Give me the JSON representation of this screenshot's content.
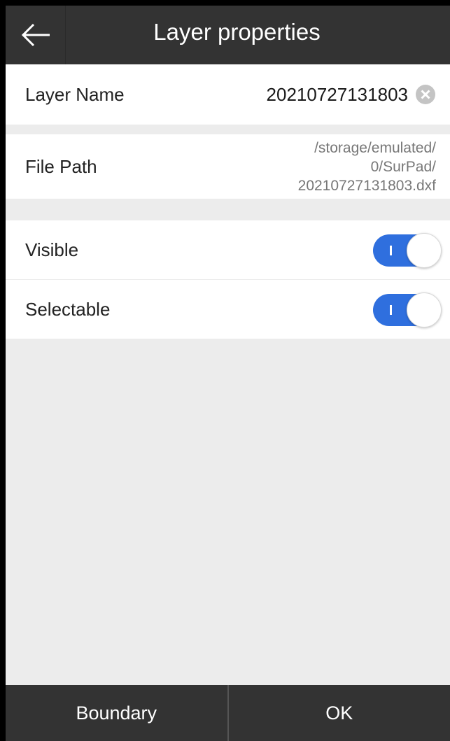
{
  "header": {
    "title": "Layer properties",
    "back_icon": "arrow-left-icon"
  },
  "layer_name": {
    "label": "Layer Name",
    "value": "20210727131803",
    "clear_icon": "clear-circle-icon"
  },
  "file_path": {
    "label": "File Path",
    "value_lines": [
      "/storage/emulated/",
      "0/SurPad/",
      "20210727131803.dxf"
    ]
  },
  "visible": {
    "label": "Visible",
    "on": true
  },
  "selectable": {
    "label": "Selectable",
    "on": true
  },
  "footer": {
    "boundary_label": "Boundary",
    "ok_label": "OK"
  },
  "colors": {
    "header_bg": "#333333",
    "toggle_on": "#2f6fde",
    "page_bg": "#ececec"
  }
}
